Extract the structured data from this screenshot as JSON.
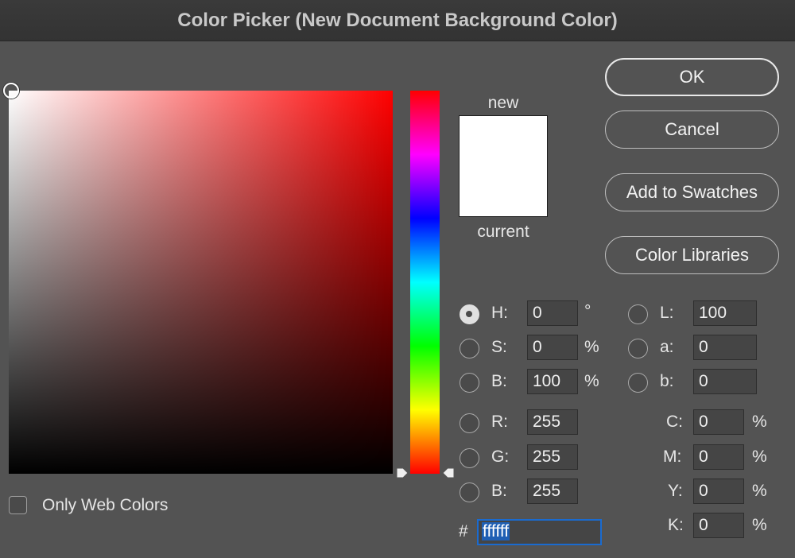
{
  "window": {
    "title": "Color Picker (New Document Background Color)"
  },
  "preview": {
    "new_label": "new",
    "current_label": "current",
    "new_color": "#ffffff",
    "current_color": "#ffffff"
  },
  "buttons": {
    "ok": "OK",
    "cancel": "Cancel",
    "add_to_swatches": "Add to Swatches",
    "color_libraries": "Color Libraries"
  },
  "hsb": {
    "h": {
      "label": "H:",
      "value": "0",
      "unit": "°",
      "selected": true
    },
    "s": {
      "label": "S:",
      "value": "0",
      "unit": "%"
    },
    "b": {
      "label": "B:",
      "value": "100",
      "unit": "%"
    }
  },
  "lab": {
    "l": {
      "label": "L:",
      "value": "100"
    },
    "a": {
      "label": "a:",
      "value": "0"
    },
    "b": {
      "label": "b:",
      "value": "0"
    }
  },
  "rgb": {
    "r": {
      "label": "R:",
      "value": "255"
    },
    "g": {
      "label": "G:",
      "value": "255"
    },
    "b": {
      "label": "B:",
      "value": "255"
    }
  },
  "cmyk": {
    "c": {
      "label": "C:",
      "value": "0",
      "unit": "%"
    },
    "m": {
      "label": "M:",
      "value": "0",
      "unit": "%"
    },
    "y": {
      "label": "Y:",
      "value": "0",
      "unit": "%"
    },
    "k": {
      "label": "K:",
      "value": "0",
      "unit": "%"
    }
  },
  "hex": {
    "label": "#",
    "value": "ffffff"
  },
  "options": {
    "only_web_colors": "Only Web Colors",
    "only_web_colors_checked": false
  },
  "colors": {
    "accent": "#1a6bd0",
    "background": "#535353",
    "hue": "#ff0000"
  }
}
